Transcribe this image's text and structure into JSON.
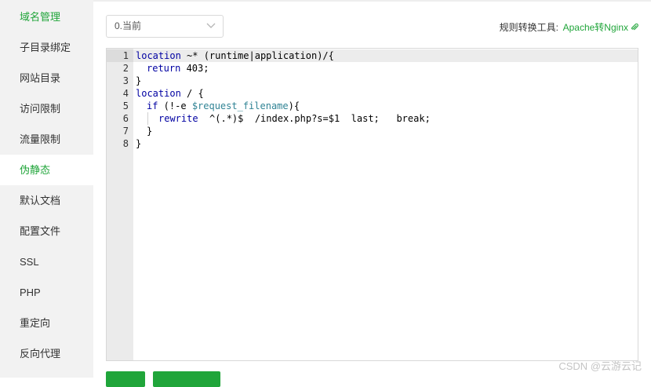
{
  "sidebar": {
    "items": [
      {
        "label": "域名管理"
      },
      {
        "label": "子目录绑定"
      },
      {
        "label": "网站目录"
      },
      {
        "label": "访问限制"
      },
      {
        "label": "流量限制"
      },
      {
        "label": "伪静态"
      },
      {
        "label": "默认文档"
      },
      {
        "label": "配置文件"
      },
      {
        "label": "SSL"
      },
      {
        "label": "PHP"
      },
      {
        "label": "重定向"
      },
      {
        "label": "反向代理"
      }
    ],
    "active_index": 5
  },
  "template_select": {
    "value": "0.当前"
  },
  "converter": {
    "label": "规则转换工具:",
    "link": "Apache转Nginx",
    "icon": "link-icon"
  },
  "editor": {
    "line_numbers": [
      "1",
      "2",
      "3",
      "4",
      "5",
      "6",
      "7",
      "8"
    ],
    "lines": {
      "l1_kw": "location",
      "l1_rest": " ~* (runtime|application)/{",
      "l2_kw": "return",
      "l2_rest": " 403;",
      "l3": "}",
      "l4_kw": "location",
      "l4_rest": " / {",
      "l5_kw": "if",
      "l5_mid": " (!-e ",
      "l5_var": "$request_filename",
      "l5_end": "){",
      "l6_kw": "rewrite",
      "l6_rest": "  ^(.*)$  /index.php?s=$1  last;   break;",
      "l7": "}",
      "l8": "}"
    }
  },
  "colors": {
    "accent": "#20a53a",
    "sidebar_bg": "#f2f2f2",
    "keyword": "#0000a2",
    "variable": "#318495"
  },
  "watermark": "CSDN @云游云记"
}
